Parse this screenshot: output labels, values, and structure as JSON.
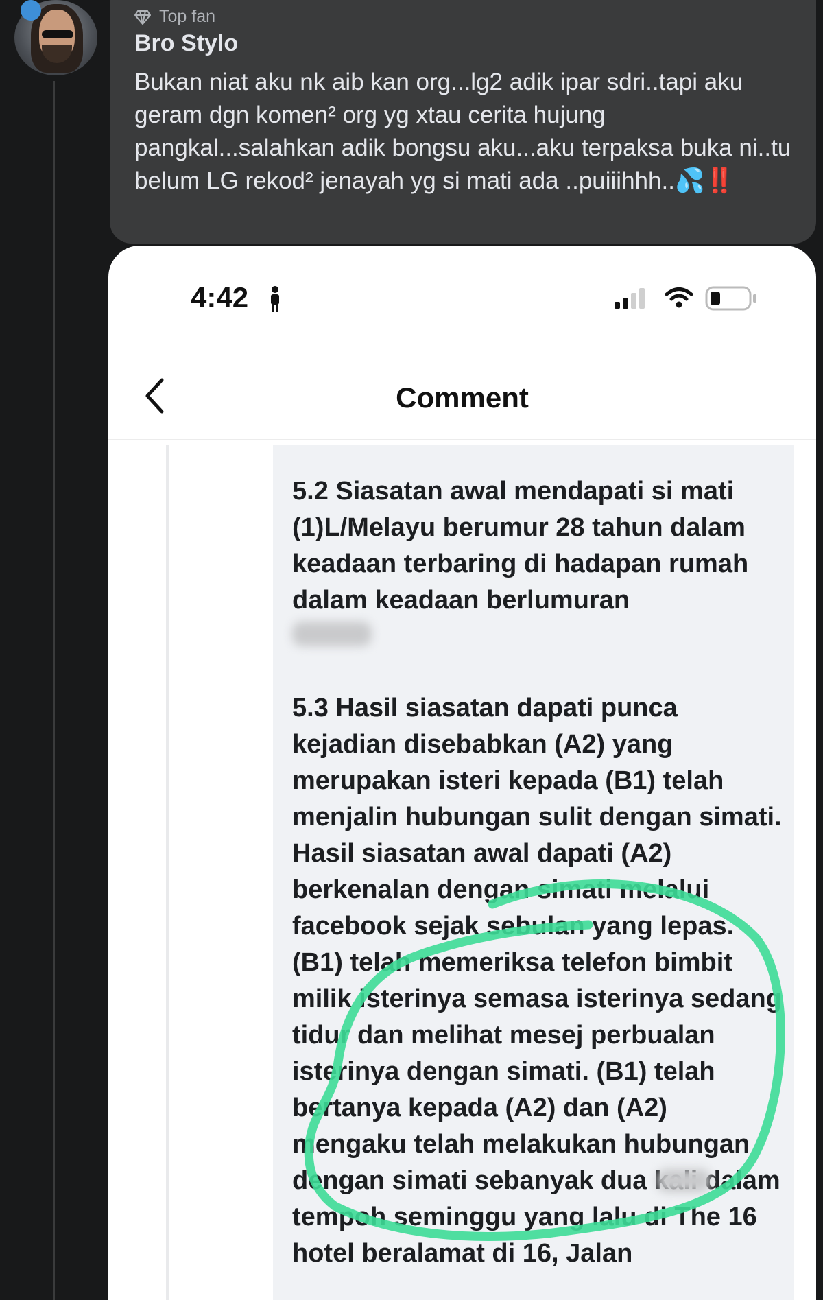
{
  "post": {
    "badge_label": "Top fan",
    "author": "Bro Stylo",
    "comment_text": "Bukan niat aku nk aib kan org...lg2 adik ipar sdri..tapi aku geram dgn komen² org yg xtau cerita hujung pangkal...salahkan adik bongsu aku...aku terpaksa buka ni..tu belum LG rekod² jenayah yg si mati ada ..puiiihhh..",
    "emoji_drops": "💦",
    "emoji_bang": "‼️"
  },
  "screenshot": {
    "status_time": "4:42",
    "nav_title": "Comment",
    "paragraph_1": "5.2 Siasatan awal mendapati si mati (1)L/Melayu berumur 28 tahun dalam keadaan terbaring di hadapan rumah dalam keadaan berlumuran",
    "paragraph_2": "5.3 Hasil siasatan dapati punca kejadian disebabkan (A2) yang merupakan isteri kepada (B1) telah menjalin hubungan sulit dengan simati. Hasil siasatan awal dapati (A2) berkenalan dengan simati melalui facebook sejak sebulan yang lepas. (B1) telah memeriksa telefon bimbit milik isterinya semasa isterinya sedang tidur dan melihat mesej perbualan isterinya dengan simati. (B1) telah bertanya kepada (A2) dan (A2) mengaku telah melakukan hubungan dengan simati sebanyak dua kali dalam tempoh seminggu yang lalu di The 16 hotel beralamat di 16, Jalan"
  },
  "colors": {
    "highlight": "#3ddc97",
    "badge": "#3e8fd8"
  },
  "icons": [
    "diamond-icon",
    "person-icon",
    "signal-icon",
    "wifi-icon",
    "battery-icon",
    "back-chevron-icon"
  ]
}
